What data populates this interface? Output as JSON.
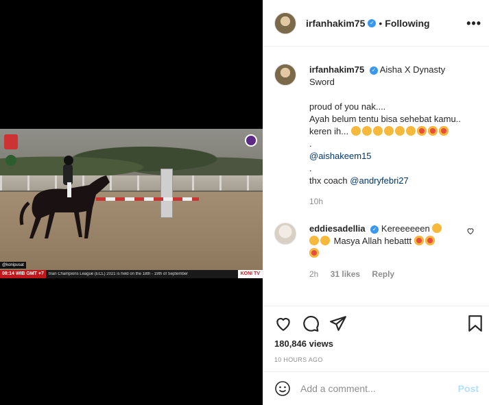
{
  "video": {
    "handle": "@konipusat",
    "time": "08:14  WIB GMT +7",
    "ticker": "trian Champions League (ECL) 2021 is held on the 18th - 19th of September",
    "brand": "KONI TV"
  },
  "header": {
    "username": "irfanhakim75",
    "follow_status": "Following",
    "more_label": "•••"
  },
  "caption": {
    "username": "irfanhakim75",
    "lines": [
      "Aisha X Dynasty",
      "Sword",
      "",
      "proud of you nak....",
      "Ayah belum tentu bisa sehebat kamu..",
      "keren ih...",
      ".",
      "@aishakeem15",
      ".",
      "thx coach",
      "@andryfebri27"
    ],
    "time": "10h"
  },
  "comment": {
    "username": "eddiesadellia",
    "text1": "Kereeeeeen",
    "text2": "Masya Allah hebattt",
    "time": "2h",
    "likes": "31 likes",
    "reply": "Reply"
  },
  "stats": {
    "views": "180,846 views",
    "time_ago": "10 HOURS AGO"
  },
  "add_comment": {
    "placeholder": "Add a comment...",
    "post": "Post"
  },
  "colors": {
    "verified": "#3897f0",
    "link": "#00376b",
    "post_disabled": "#b2dffc",
    "ticker_red": "#c0171c"
  }
}
